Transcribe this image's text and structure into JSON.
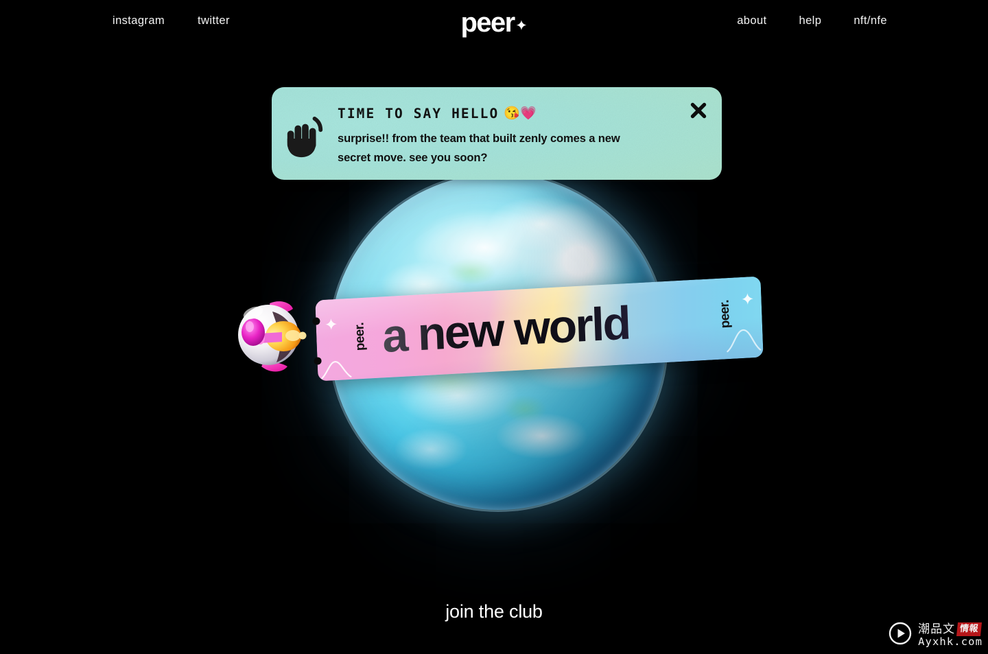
{
  "site": {
    "background_color": "#000000",
    "logo_text": "peer",
    "logo_icon": "sparkle-four-point"
  },
  "nav": {
    "left_links": [
      {
        "label": "instagram",
        "name": "instagram"
      },
      {
        "label": "twitter",
        "name": "twitter"
      }
    ],
    "right_links": [
      {
        "label": "about",
        "name": "about"
      },
      {
        "label": "help",
        "name": "help"
      },
      {
        "label": "nft/nfe",
        "name": "nft-nfe"
      }
    ]
  },
  "hello_banner": {
    "icon": "waving-hand-icon",
    "title": "TIME TO SAY HELLO",
    "title_emojis": "😘💗",
    "body": "surprise!! from the team that built zenly comes a new secret move. see you soon?",
    "close_label": "✕",
    "background_color": "#a8e6de",
    "text_color": "#111111"
  },
  "hero": {
    "planet_alt": "earth-planet",
    "rocket_alt": "rocket-capsule-character",
    "banner": {
      "headline": "a new world",
      "brand_left": "peer.",
      "brand_right": "peer.",
      "gradient_start": "#f3a9e0",
      "gradient_mid": "#eadcb4",
      "gradient_end": "#80d8f1"
    }
  },
  "footer": {
    "cta_label": "join the club"
  },
  "watermark": {
    "play_icon": "play-circle-icon",
    "cn_text": "潮品文",
    "badge_text": "情報",
    "domain": "Ayxhk.com"
  }
}
